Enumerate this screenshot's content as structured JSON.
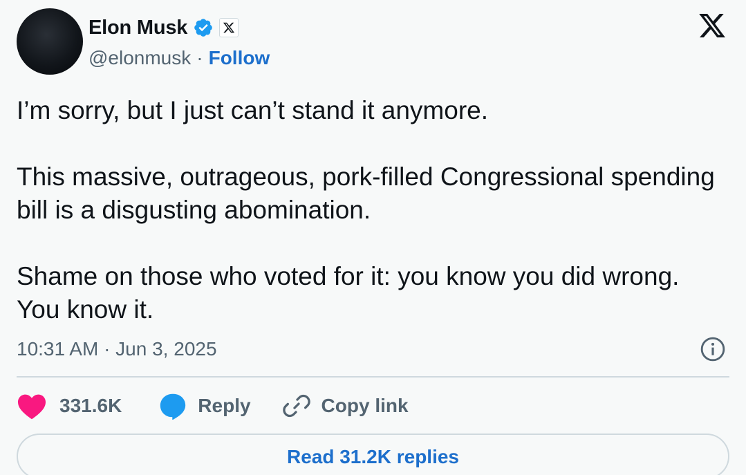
{
  "author": {
    "name": "Elon Musk",
    "handle": "@elonmusk",
    "separator": "·",
    "follow_label": "Follow",
    "avatar_icon": "avatar-image",
    "verified_icon": "verified-badge-icon",
    "affiliate_icon": "x-affiliate-badge-icon"
  },
  "brand": {
    "logo_icon": "x-logo-icon"
  },
  "tweet": {
    "text": "I’m sorry, but I just can’t stand it anymore.\n\nThis massive, outrageous, pork-filled Congressional spending bill is a disgusting abomination.\n\nShame on those who voted for it: you know you did wrong. You know it.",
    "timestamp": "10:31 AM · Jun 3, 2025",
    "info_icon": "info-icon"
  },
  "actions": {
    "likes_count": "331.6K",
    "like_icon": "heart-icon",
    "reply_label": "Reply",
    "reply_icon": "speech-bubble-icon",
    "copy_link_label": "Copy link",
    "copy_icon": "link-icon"
  },
  "replies": {
    "read_label": "Read 31.2K replies"
  },
  "colors": {
    "background": "#f7f9f9",
    "text": "#0f1419",
    "secondary_text": "#536471",
    "link_blue": "#1d6fcc",
    "verified_blue": "#1d9bf0",
    "like_pink": "#f91880",
    "divider": "#cfd9de"
  }
}
